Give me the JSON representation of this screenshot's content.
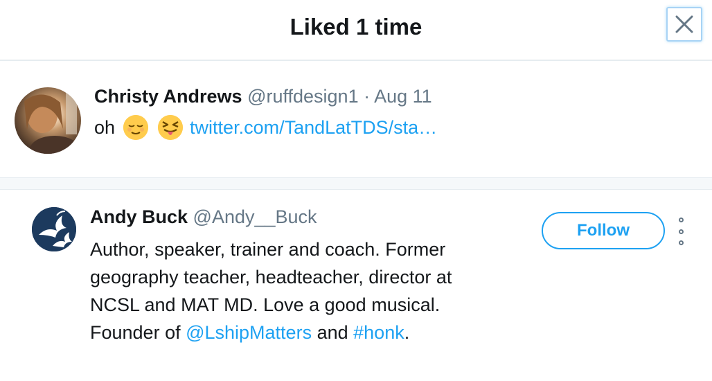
{
  "modal": {
    "title": "Liked 1 time",
    "close_icon": "close-icon"
  },
  "tweet": {
    "author_name": "Christy Andrews",
    "author_handle": "@ruffdesign1",
    "separator": "·",
    "date": "Aug 11",
    "text": "oh",
    "emojis": [
      "relieved-face-emoji",
      "squinting-face-with-tongue-emoji"
    ],
    "link": "twitter.com/TandLatTDS/sta…"
  },
  "user": {
    "name": "Andy Buck",
    "handle": "@Andy__Buck",
    "bio_text": "Author, speaker, trainer and coach. Former geography teacher, headteacher, director at NCSL and MAT MD. Love a good musical. Founder of ",
    "bio_mention": "@LshipMatters",
    "bio_and": " and ",
    "bio_hashtag": "#honk",
    "bio_end": ".",
    "follow_label": "Follow",
    "more_icon": "more-vertical-icon"
  },
  "colors": {
    "accent": "#1da1f2",
    "muted": "#657786",
    "text": "#14171a",
    "divider": "#e6ecf0"
  }
}
